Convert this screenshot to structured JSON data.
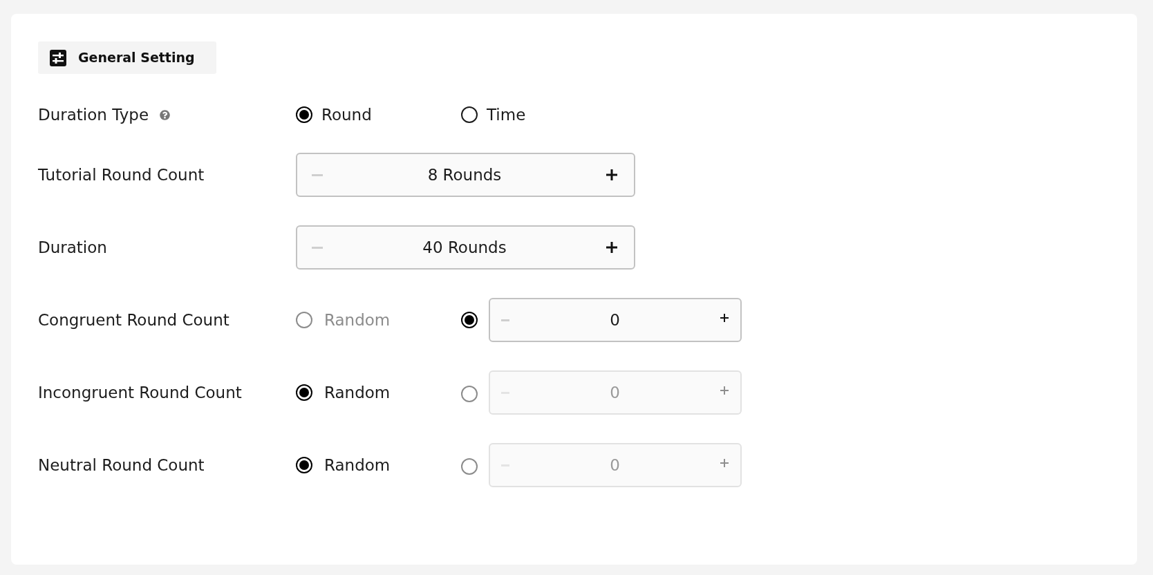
{
  "section": {
    "title": "General Setting"
  },
  "rows": [
    {
      "kind": "choice",
      "label": "Duration Type",
      "help": true,
      "options": [
        {
          "label": "Round",
          "selected": true
        },
        {
          "label": "Time",
          "selected": false
        }
      ]
    },
    {
      "kind": "stepper",
      "label": "Tutorial Round Count",
      "help": false,
      "stepper": {
        "value": "8 Rounds",
        "decrement_disabled": true
      }
    },
    {
      "kind": "stepper",
      "label": "Duration",
      "help": false,
      "stepper": {
        "value": "40 Rounds",
        "decrement_disabled": true
      }
    },
    {
      "kind": "random_or_count",
      "label": "Congruent Round Count",
      "help": false,
      "random": {
        "label": "Random",
        "selected": false
      },
      "count": {
        "selected": true,
        "stepper": {
          "value": "0",
          "decrement_disabled": true
        }
      }
    },
    {
      "kind": "random_or_count",
      "label": "Incongruent Round Count",
      "help": false,
      "random": {
        "label": "Random",
        "selected": true
      },
      "count": {
        "selected": false,
        "stepper": {
          "value": "0",
          "decrement_disabled": true
        }
      }
    },
    {
      "kind": "random_or_count",
      "label": "Neutral Round Count",
      "help": false,
      "random": {
        "label": "Random",
        "selected": true
      },
      "count": {
        "selected": false,
        "stepper": {
          "value": "0",
          "decrement_disabled": true
        }
      }
    }
  ]
}
